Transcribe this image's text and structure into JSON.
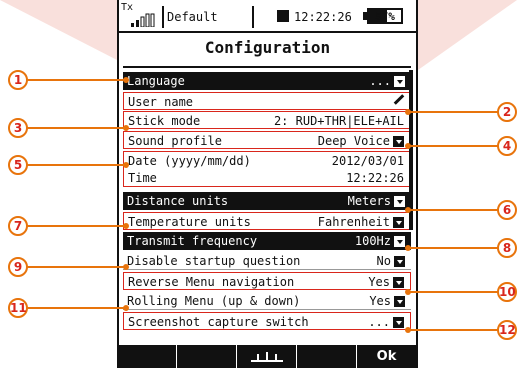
{
  "status_bar": {
    "tx_label": "Tx",
    "model_name": "Default",
    "clock": "12:22:26",
    "battery_text": "57%",
    "battery_level": 0.57
  },
  "screen": {
    "title": "Configuration"
  },
  "settings": [
    {
      "label": "Language",
      "value": "...",
      "control": "dropdown",
      "style": "dark"
    },
    {
      "label": "User name",
      "value": "",
      "control": "edit",
      "style": "outlined"
    },
    {
      "label": "Stick mode",
      "value": "2: RUD+THR|ELE+AIL",
      "control": "none",
      "style": "outlined"
    },
    {
      "label": "Sound profile",
      "value": "Deep Voice",
      "control": "dropdown",
      "style": "outlined"
    },
    {
      "label": "Date (yyyy/mm/dd)",
      "value": "2012/03/01",
      "control": "none",
      "style": "outlined-top"
    },
    {
      "label": "Time",
      "value": "12:22:26",
      "control": "none",
      "style": "outlined-bottom"
    },
    {
      "label": "Distance units",
      "value": "Meters",
      "control": "dropdown",
      "style": "dark"
    },
    {
      "label": "Temperature units",
      "value": "Fahrenheit",
      "control": "dropdown",
      "style": "outlined"
    },
    {
      "label": "Transmit frequency",
      "value": "100Hz",
      "control": "dropdown",
      "style": "dark"
    },
    {
      "label": "Disable startup question",
      "value": "No",
      "control": "dropdown",
      "style": "sep"
    },
    {
      "label": "Reverse Menu navigation",
      "value": "Yes",
      "control": "dropdown",
      "style": "outlined"
    },
    {
      "label": "Rolling Menu (up & down)",
      "value": "Yes",
      "control": "dropdown",
      "style": "sep"
    },
    {
      "label": "Screenshot capture switch",
      "value": "...",
      "control": "dropdown",
      "style": "outlined"
    }
  ],
  "bottom_bar": {
    "keys": [
      "",
      "",
      "trim-icon",
      "",
      "Ok"
    ]
  },
  "callouts": [
    "1",
    "2",
    "3",
    "4",
    "5",
    "6",
    "7",
    "8",
    "9",
    "10",
    "11",
    "12"
  ],
  "colors": {
    "callout_text": "#d9261c",
    "callout_ring": "#e8740c",
    "decor": "#f4d3cf"
  }
}
